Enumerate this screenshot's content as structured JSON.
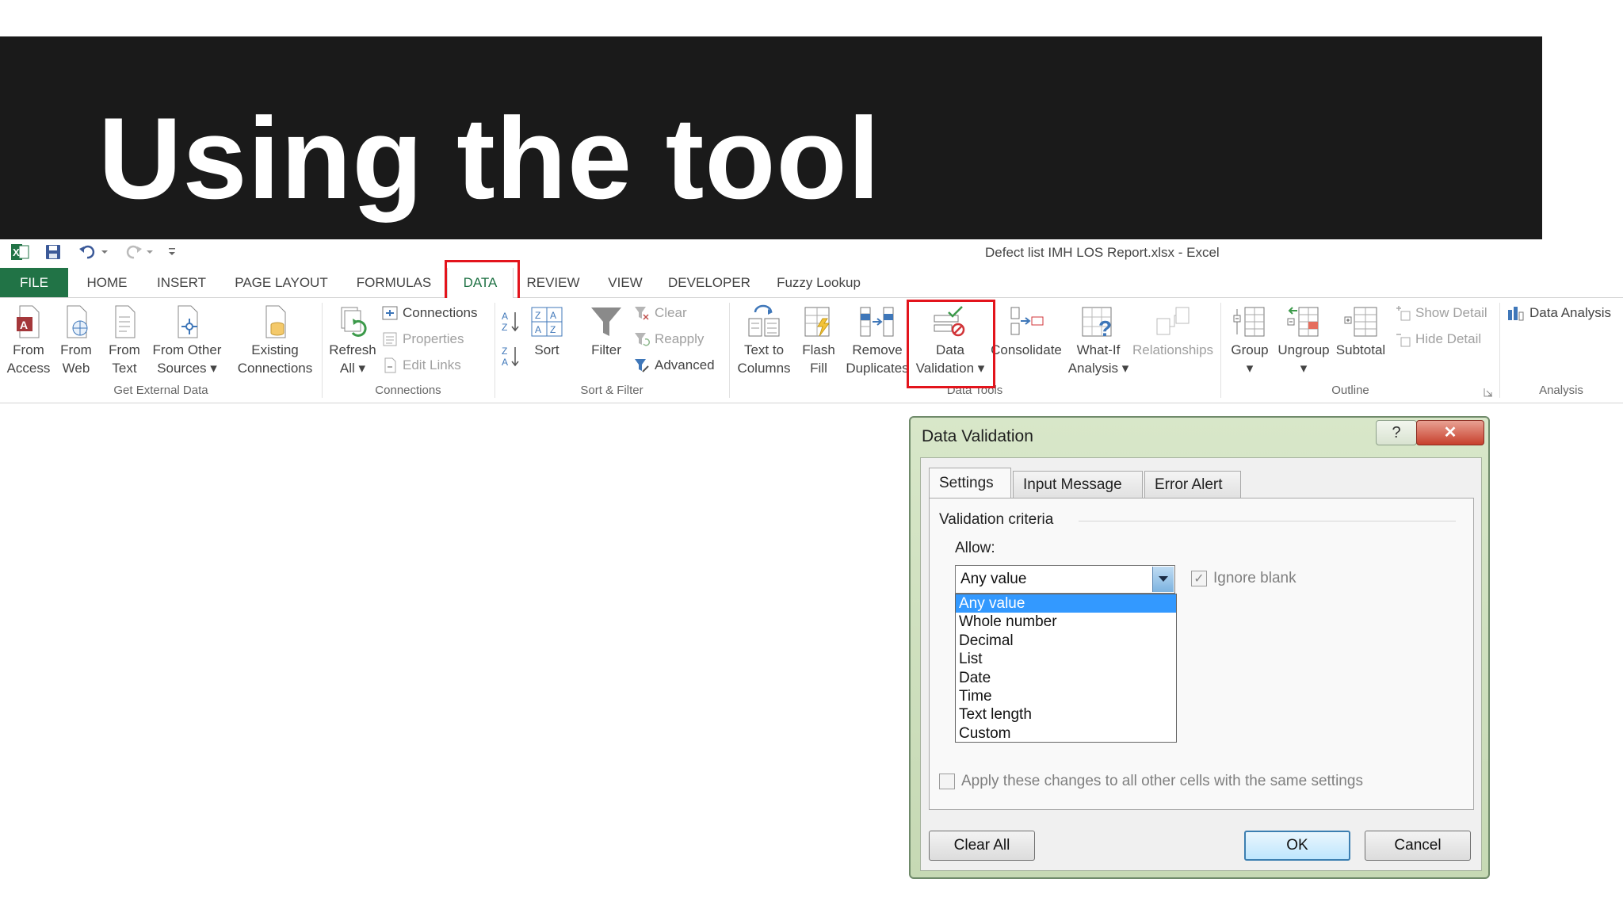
{
  "slide": {
    "title": "Using the tool"
  },
  "window": {
    "title": "Defect list IMH LOS Report.xlsx - Excel"
  },
  "quick_access": {
    "icons": [
      "excel-icon",
      "save-icon",
      "undo-icon",
      "redo-icon",
      "customize-icon"
    ]
  },
  "tabs": [
    {
      "label": "FILE"
    },
    {
      "label": "HOME"
    },
    {
      "label": "INSERT"
    },
    {
      "label": "PAGE LAYOUT"
    },
    {
      "label": "FORMULAS"
    },
    {
      "label": "DATA"
    },
    {
      "label": "REVIEW"
    },
    {
      "label": "VIEW"
    },
    {
      "label": "DEVELOPER"
    },
    {
      "label": "Fuzzy Lookup"
    }
  ],
  "ribbon": {
    "get_external": {
      "label": "Get External Data",
      "from_access": [
        "From",
        "Access"
      ],
      "from_web": [
        "From",
        "Web"
      ],
      "from_text": [
        "From",
        "Text"
      ],
      "from_other": [
        "From Other",
        "Sources ▾"
      ],
      "existing": [
        "Existing",
        "Connections"
      ]
    },
    "connections": {
      "label": "Connections",
      "refresh": [
        "Refresh",
        "All ▾"
      ],
      "connections": "Connections",
      "properties": "Properties",
      "edit_links": "Edit Links"
    },
    "sort_filter": {
      "label": "Sort & Filter",
      "sort": "Sort",
      "filter": "Filter",
      "clear": "Clear",
      "reapply": "Reapply",
      "advanced": "Advanced"
    },
    "data_tools": {
      "label": "Data Tools",
      "text_to_columns": [
        "Text to",
        "Columns"
      ],
      "flash_fill": [
        "Flash",
        "Fill"
      ],
      "remove_duplicates": [
        "Remove",
        "Duplicates"
      ],
      "data_validation": [
        "Data",
        "Validation ▾"
      ],
      "consolidate": "Consolidate",
      "what_if": [
        "What-If",
        "Analysis ▾"
      ],
      "relationships": "Relationships"
    },
    "outline": {
      "label": "Outline",
      "group": "Group",
      "ungroup": "Ungroup",
      "subtotal": "Subtotal",
      "show_detail": "Show Detail",
      "hide_detail": "Hide Detail"
    },
    "analysis": {
      "label": "Analysis",
      "data_analysis": "Data Analysis"
    }
  },
  "dialog": {
    "title": "Data Validation",
    "help": "?",
    "close": "✕",
    "tabs": [
      "Settings",
      "Input Message",
      "Error Alert"
    ],
    "criteria_legend": "Validation criteria",
    "allow_label": "Allow:",
    "allow_value": "Any value",
    "allow_options": [
      "Any value",
      "Whole number",
      "Decimal",
      "List",
      "Date",
      "Time",
      "Text length",
      "Custom"
    ],
    "ignore_blank": "Ignore blank",
    "apply_all": "Apply these changes to all other cells with the same settings",
    "clear_all": "Clear All",
    "ok": "OK",
    "cancel": "Cancel"
  }
}
